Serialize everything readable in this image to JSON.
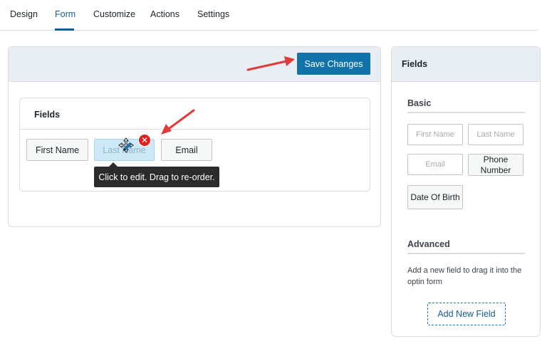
{
  "tabs": [
    {
      "label": "Design"
    },
    {
      "label": "Form"
    },
    {
      "label": "Customize"
    },
    {
      "label": "Actions"
    },
    {
      "label": "Settings"
    }
  ],
  "active_tab": "Form",
  "main": {
    "save_label": "Save Changes",
    "fields_title": "Fields",
    "chips": [
      {
        "label": "First Name"
      },
      {
        "label": "Last Name"
      },
      {
        "label": "Email"
      }
    ],
    "remove_icon": "close-circle-icon",
    "tooltip": "Click to edit. Drag to re-order."
  },
  "sidebar": {
    "title": "Fields",
    "basic_title": "Basic",
    "basic_fields": [
      {
        "label": "First Name"
      },
      {
        "label": "Last Name"
      },
      {
        "label": "Email"
      },
      {
        "label": "Phone Number"
      },
      {
        "label": "Date Of Birth"
      }
    ],
    "advanced_title": "Advanced",
    "advanced_text": "Add a new field to drag it into the optin form",
    "add_field_label": "Add New Field"
  },
  "colors": {
    "accent": "#135e96",
    "save_button": "#1273ab",
    "annotation_arrow": "#e03a3a",
    "remove_icon": "#e0201f"
  }
}
